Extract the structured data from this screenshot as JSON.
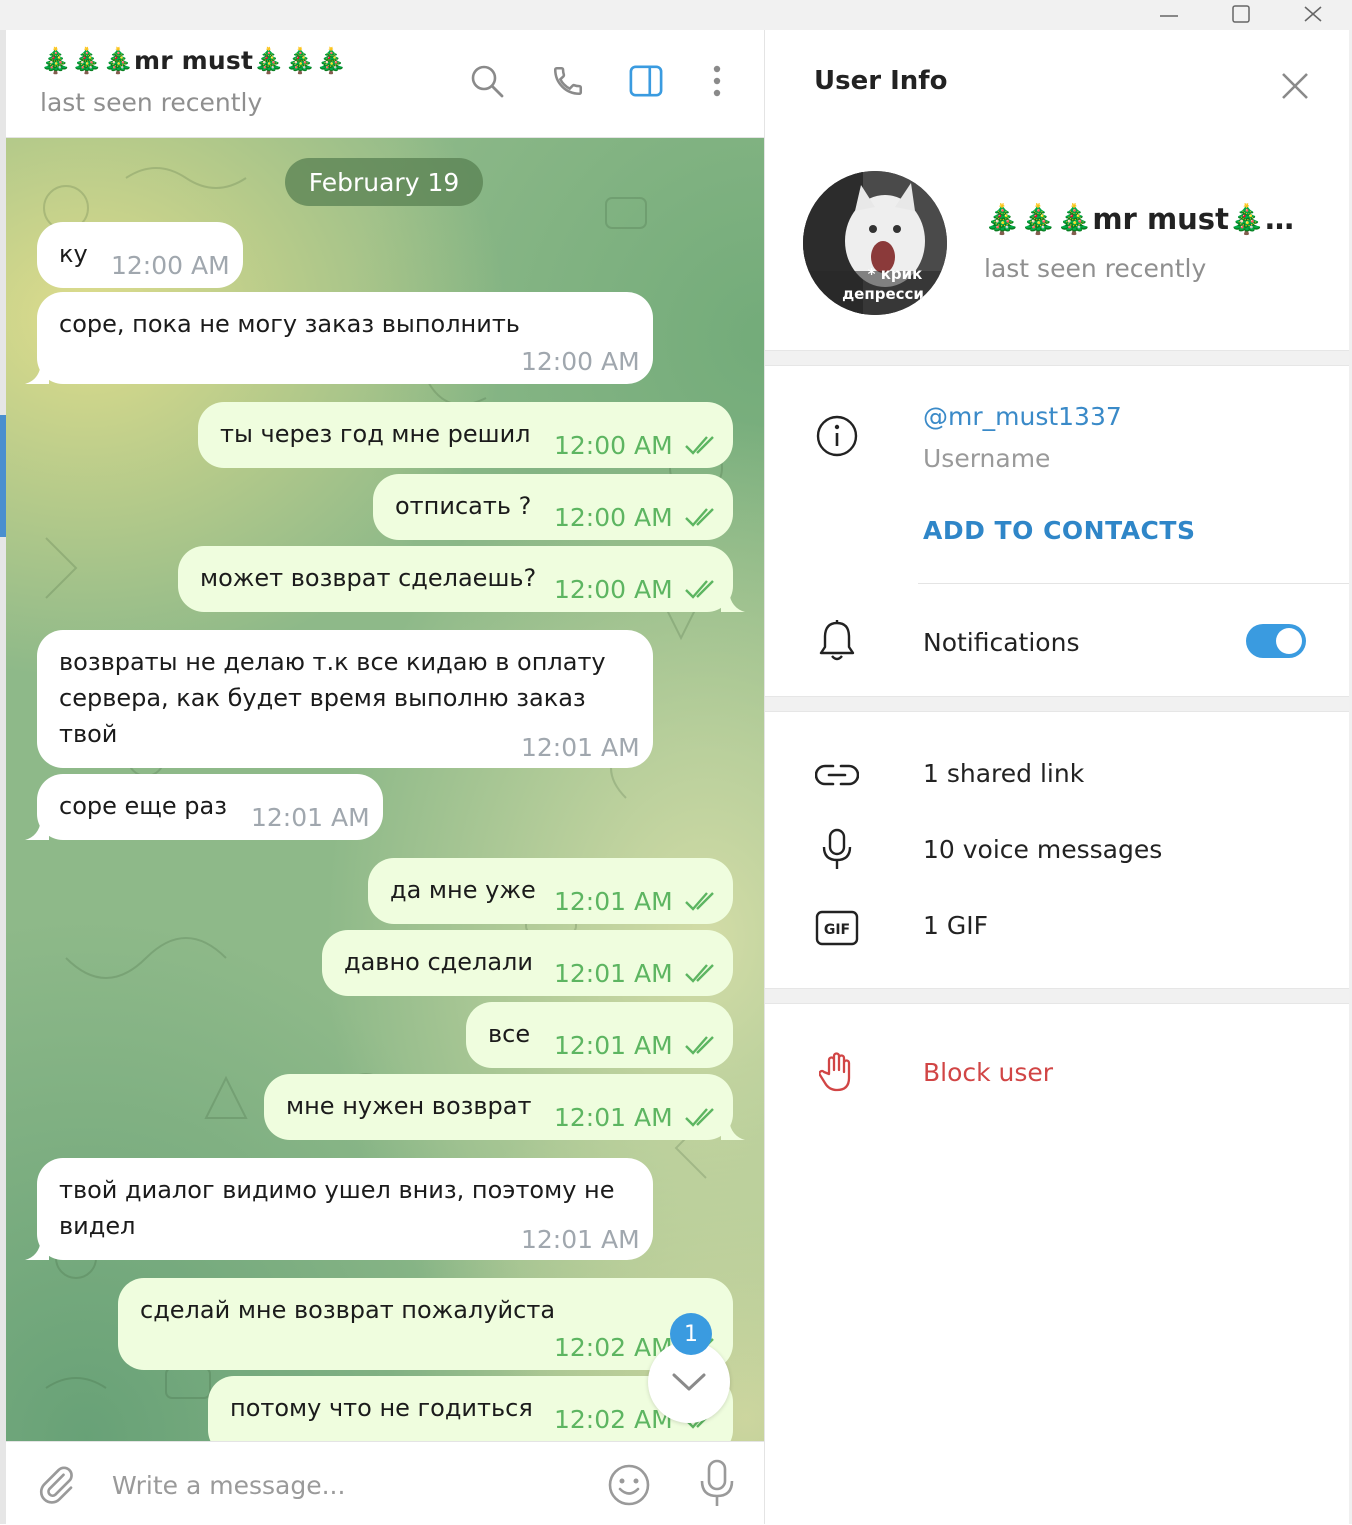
{
  "window": {
    "minimize_icon": "minimize-icon",
    "maximize_icon": "maximize-icon",
    "close_icon": "close-icon"
  },
  "chat_header": {
    "title": "🎄🎄🎄mr must🎄🎄🎄",
    "status": "last seen recently",
    "icons": [
      "search-icon",
      "phone-icon",
      "sidebar-toggle-icon",
      "more-vertical-icon"
    ]
  },
  "messages": {
    "date": "February 19",
    "items": [
      {
        "dir": "in",
        "text": "ку",
        "time": "12:00 AM"
      },
      {
        "dir": "in",
        "text": "соре, пока не могу заказ выполнить",
        "time": "12:00 AM"
      },
      {
        "dir": "out",
        "text": "ты через год мне решил",
        "time": "12:00 AM",
        "read": true
      },
      {
        "dir": "out",
        "text": "отписать ?",
        "time": "12:00 AM",
        "read": true
      },
      {
        "dir": "out",
        "text": "может возврат сделаешь?",
        "time": "12:00 AM",
        "read": true
      },
      {
        "dir": "in",
        "text": "возвраты не делаю т.к все кидаю в оплату\nсервера, как будет время выполню заказ\nтвой",
        "time": "12:01 AM"
      },
      {
        "dir": "in",
        "text": "соре еще раз",
        "time": "12:01 AM"
      },
      {
        "dir": "out",
        "text": "да мне уже",
        "time": "12:01 AM",
        "read": true
      },
      {
        "dir": "out",
        "text": "давно сделали",
        "time": "12:01 AM",
        "read": true
      },
      {
        "dir": "out",
        "text": "все",
        "time": "12:01 AM",
        "read": true
      },
      {
        "dir": "out",
        "text": "мне нужен возврат",
        "time": "12:01 AM",
        "read": true
      },
      {
        "dir": "in",
        "text": "твой диалог видимо ушел вниз, поэтому не\nвидел",
        "time": "12:01 AM"
      },
      {
        "dir": "out",
        "text": "сделай мне возврат пожалуйста",
        "time": "12:02 AM",
        "read": true
      },
      {
        "dir": "out",
        "text": "потому что не годиться",
        "time": "12:02 AM",
        "read": true
      }
    ],
    "unread_badge": "1"
  },
  "composer": {
    "placeholder": "Write a message...",
    "icons": [
      "attach-icon",
      "emoji-icon",
      "microphone-icon"
    ]
  },
  "user_info": {
    "title": "User Info",
    "avatar_caption": "* крик депресси",
    "name": "🎄🎄🎄mr must🎄…",
    "status": "last seen recently",
    "username": "@mr_must1337",
    "username_label": "Username",
    "add_contacts": "ADD TO CONTACTS",
    "notifications_label": "Notifications",
    "notifications_on": true,
    "shared_link": "1 shared link",
    "voice_messages": "10 voice messages",
    "gifs": "1 GIF",
    "block": "Block user"
  },
  "colors": {
    "accent": "#3a9be0",
    "link": "#3a8ac8",
    "danger": "#d14545",
    "out_bubble": "#effdde",
    "out_time": "#5db561"
  }
}
